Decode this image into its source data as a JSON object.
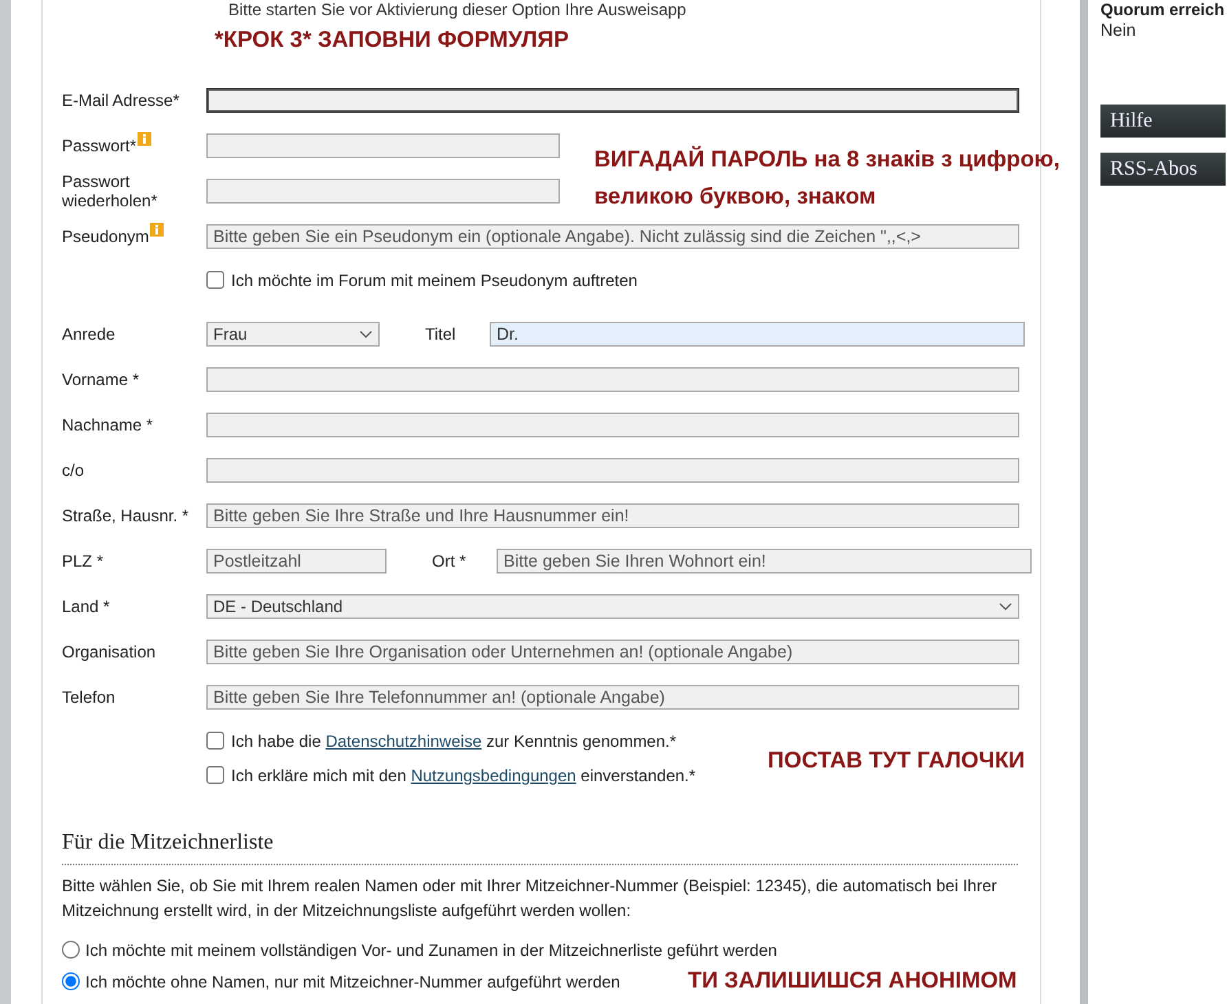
{
  "intro_text": "Bitte starten Sie vor Aktivierung dieser Option Ihre Ausweisapp",
  "fields": [
    {
      "kind": "text",
      "label": "E-Mail Adresse*",
      "focused": true
    },
    {
      "kind": "password",
      "label": "Passwort*",
      "info": true
    },
    {
      "kind": "password",
      "label": "Passwort wiederholen*"
    },
    {
      "kind": "text",
      "label": "Pseudonym",
      "info": true,
      "placeholder": "Bitte geben Sie ein Pseudonym ein (optionale Angabe). Nicht zulässig sind die Zeichen \",,<,>"
    },
    {
      "kind": "checkbox",
      "text_before": "Ich möchte im Forum mit meinem Pseudonym auftreten",
      "checked": false
    },
    {
      "kind": "select-pair",
      "label": "Anrede",
      "value": "Frau",
      "second": {
        "label": "Titel",
        "value": "Dr.",
        "autofilled": true
      }
    },
    {
      "kind": "text",
      "label": "Vorname *"
    },
    {
      "kind": "text",
      "label": "Nachname *"
    },
    {
      "kind": "text",
      "label": "c/o"
    },
    {
      "kind": "text",
      "label": "Straße, Hausnr. *",
      "placeholder": "Bitte geben Sie Ihre Straße und Ihre Hausnummer ein!"
    },
    {
      "kind": "text-pair",
      "label": "PLZ *",
      "placeholder": "Postleitzahl",
      "second": {
        "label": "Ort *",
        "placeholder": "Bitte geben Sie Ihren Wohnort ein!"
      }
    },
    {
      "kind": "select",
      "label": "Land *",
      "value": "DE - Deutschland"
    },
    {
      "kind": "text",
      "label": "Organisation",
      "placeholder": "Bitte geben Sie Ihre Organisation oder Unternehmen an! (optionale Angabe)"
    },
    {
      "kind": "text",
      "label": "Telefon",
      "placeholder": "Bitte geben Sie Ihre Telefonnummer an! (optionale Angabe)"
    },
    {
      "kind": "checkbox",
      "text_before": "Ich habe die ",
      "link": "Datenschutzhinweise",
      "text_after": " zur Kenntnis genommen.*",
      "checked": false
    },
    {
      "kind": "checkbox",
      "text_before": "Ich erkläre mich mit den ",
      "link": "Nutzungsbedingungen",
      "text_after": " einverstanden.*",
      "checked": false
    }
  ],
  "mitzeichnerliste": {
    "heading": "Für die Mitzeichnerliste",
    "description": "Bitte wählen Sie, ob Sie mit Ihrem realen Namen oder mit Ihrer Mitzeichner-Nummer (Beispiel: 12345), die automatisch bei Ihrer Mitzeichnung erstellt wird, in der Mitzeichnungsliste aufgeführt werden wollen:",
    "options": [
      {
        "label": "Ich möchte mit meinem vollständigen Vor- und Zunamen in der Mitzeichnerliste geführt werden",
        "selected": false
      },
      {
        "label": "Ich möchte ohne Namen, nur mit Mitzeichner-Nummer aufgeführt werden",
        "selected": true
      }
    ]
  },
  "sidebar": {
    "quorum_label": "Quorum erreich",
    "quorum_value": "Nein",
    "buttons": [
      "Hilfe",
      "RSS-Abos"
    ]
  },
  "annotations": [
    {
      "text": "*КРОК 3* ЗАПОВНИ ФОРМУЛЯР"
    },
    {
      "text": "ВИГАДАЙ ПАРОЛЬ на 8 знаків з цифрою,"
    },
    {
      "text": "великою буквою, знаком"
    },
    {
      "text": "ПОСТАВ ТУТ ГАЛОЧКИ"
    },
    {
      "text": "ТИ ЗАЛИШИШСЯ АНОНІМОМ"
    }
  ]
}
